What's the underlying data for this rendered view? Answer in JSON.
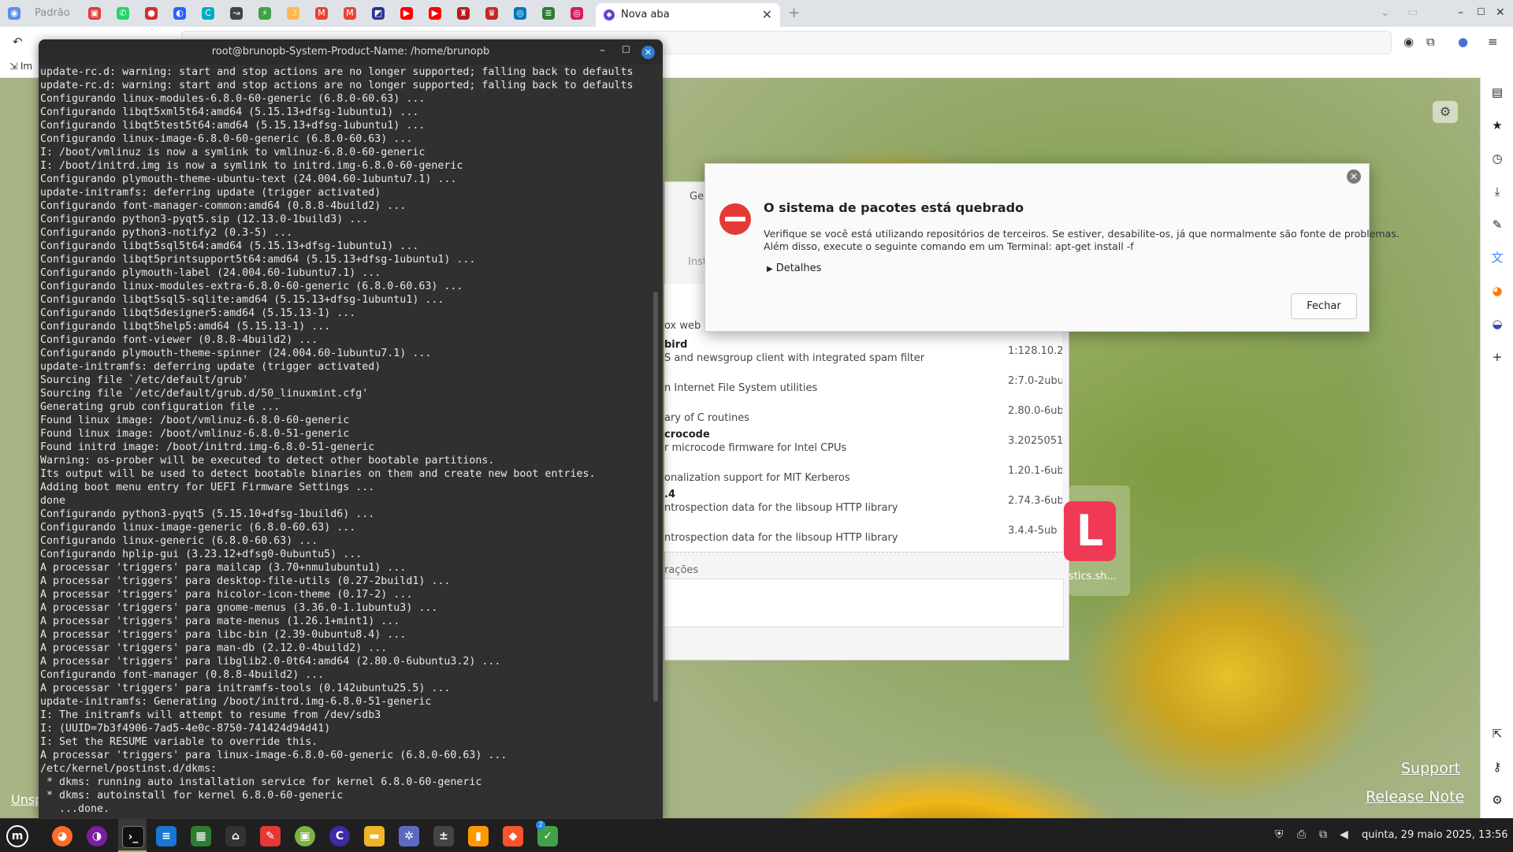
{
  "browser": {
    "profile_label": "Padrão",
    "active_tab_title": "Nova aba",
    "bookmark_label": "Im",
    "support_link": "Support",
    "release_link": "Release Note",
    "unsp_link": "Unsp"
  },
  "terminal": {
    "title": "root@brunopb-System-Product-Name: /home/brunopb",
    "lines": [
      "update-rc.d: warning: start and stop actions are no longer supported; falling back to defaults",
      "update-rc.d: warning: start and stop actions are no longer supported; falling back to defaults",
      "Configurando linux-modules-6.8.0-60-generic (6.8.0-60.63) ...",
      "Configurando libqt5xml5t64:amd64 (5.15.13+dfsg-1ubuntu1) ...",
      "Configurando libqt5test5t64:amd64 (5.15.13+dfsg-1ubuntu1) ...",
      "Configurando linux-image-6.8.0-60-generic (6.8.0-60.63) ...",
      "I: /boot/vmlinuz is now a symlink to vmlinuz-6.8.0-60-generic",
      "I: /boot/initrd.img is now a symlink to initrd.img-6.8.0-60-generic",
      "Configurando plymouth-theme-ubuntu-text (24.004.60-1ubuntu7.1) ...",
      "update-initramfs: deferring update (trigger activated)",
      "Configurando font-manager-common:amd64 (0.8.8-4build2) ...",
      "Configurando python3-pyqt5.sip (12.13.0-1build3) ...",
      "Configurando python3-notify2 (0.3-5) ...",
      "Configurando libqt5sql5t64:amd64 (5.15.13+dfsg-1ubuntu1) ...",
      "Configurando libqt5printsupport5t64:amd64 (5.15.13+dfsg-1ubuntu1) ...",
      "Configurando plymouth-label (24.004.60-1ubuntu7.1) ...",
      "Configurando linux-modules-extra-6.8.0-60-generic (6.8.0-60.63) ...",
      "Configurando libqt5sql5-sqlite:amd64 (5.15.13+dfsg-1ubuntu1) ...",
      "Configurando libqt5designer5:amd64 (5.15.13-1) ...",
      "Configurando libqt5help5:amd64 (5.15.13-1) ...",
      "Configurando font-viewer (0.8.8-4build2) ...",
      "Configurando plymouth-theme-spinner (24.004.60-1ubuntu7.1) ...",
      "update-initramfs: deferring update (trigger activated)",
      "Sourcing file `/etc/default/grub'",
      "Sourcing file `/etc/default/grub.d/50_linuxmint.cfg'",
      "Generating grub configuration file ...",
      "Found linux image: /boot/vmlinuz-6.8.0-60-generic",
      "Found linux image: /boot/vmlinuz-6.8.0-51-generic",
      "Found initrd image: /boot/initrd.img-6.8.0-51-generic",
      "Warning: os-prober will be executed to detect other bootable partitions.",
      "Its output will be used to detect bootable binaries on them and create new boot entries.",
      "Adding boot menu entry for UEFI Firmware Settings ...",
      "done",
      "Configurando python3-pyqt5 (5.15.10+dfsg-1build6) ...",
      "Configurando linux-image-generic (6.8.0-60.63) ...",
      "Configurando linux-generic (6.8.0-60.63) ...",
      "Configurando hplip-gui (3.23.12+dfsg0-0ubuntu5) ...",
      "A processar 'triggers' para mailcap (3.70+nmu1ubuntu1) ...",
      "A processar 'triggers' para desktop-file-utils (0.27-2build1) ...",
      "A processar 'triggers' para hicolor-icon-theme (0.17-2) ...",
      "A processar 'triggers' para gnome-menus (3.36.0-1.1ubuntu3) ...",
      "A processar 'triggers' para mate-menus (1.26.1+mint1) ...",
      "A processar 'triggers' para libc-bin (2.39-0ubuntu8.4) ...",
      "A processar 'triggers' para man-db (2.12.0-4build2) ...",
      "A processar 'triggers' para libglib2.0-0t64:amd64 (2.80.0-6ubuntu3.2) ...",
      "Configurando font-manager (0.8.8-4build2) ...",
      "A processar 'triggers' para initramfs-tools (0.142ubuntu25.5) ...",
      "update-initramfs: Generating /boot/initrd.img-6.8.0-51-generic",
      "I: The initramfs will attempt to resume from /dev/sdb3",
      "I: (UUID=7b3f4906-7ad5-4e0c-8750-741424d94d41)",
      "I: Set the RESUME variable to override this.",
      "A processar 'triggers' para linux-image-6.8.0-60-generic (6.8.0-60.63) ...",
      "/etc/kernel/postinst.d/dkms:",
      " * dkms: running auto installation service for kernel 6.8.0-60-generic",
      " * dkms: autoinstall for kernel 6.8.0-60-generic",
      "   ...done."
    ]
  },
  "update_manager": {
    "tab_label": "Ger",
    "section_label": "Inst",
    "desc_label": "rações",
    "packages": [
      {
        "name": "",
        "desc": "ox web browser",
        "ver": ""
      },
      {
        "name": "bird",
        "desc": "S and newsgroup client with integrated spam filter",
        "ver": "1:128.10.2"
      },
      {
        "name": "",
        "desc": "n Internet File System utilities",
        "ver": "2:7.0-2ubu"
      },
      {
        "name": "",
        "desc": "ary of C routines",
        "ver": "2.80.0-6ub"
      },
      {
        "name": "crocode",
        "desc": "r microcode firmware for Intel CPUs",
        "ver": "3.2025051"
      },
      {
        "name": "",
        "desc": "onalization support for MIT Kerberos",
        "ver": "1.20.1-6ub"
      },
      {
        "name": ".4",
        "desc": "ntrospection data for the libsoup HTTP library",
        "ver": "2.74.3-6ub"
      },
      {
        "name": "",
        "desc": "ntrospection data for the libsoup HTTP library",
        "ver": "3.4.4-5ub"
      }
    ]
  },
  "desktop_icon": {
    "label": "stics.sh...",
    "letter": "L"
  },
  "dialog": {
    "title": "O sistema de pacotes está quebrado",
    "message_line1": "Verifique se você está utilizando repositórios de terceiros. Se estiver, desabilite-os, já que normalmente são fonte de problemas.",
    "message_line2": "Além disso, execute o seguinte comando em um Terminal: apt-get install -f",
    "details_label": "Detalhes",
    "close_button": "Fechar"
  },
  "taskbar": {
    "clock": "quinta, 29 maio 2025, 13:56",
    "badge_count": "2"
  },
  "icons": {
    "menu": "mint-menu-icon",
    "terminal": "terminal-icon",
    "files": "folder-icon"
  },
  "colors": {
    "dialog_error": "#e53935",
    "terminal_bg": "#303030",
    "taskbar_bg": "#1f1f1f",
    "close_blue": "#2e7fd6"
  }
}
